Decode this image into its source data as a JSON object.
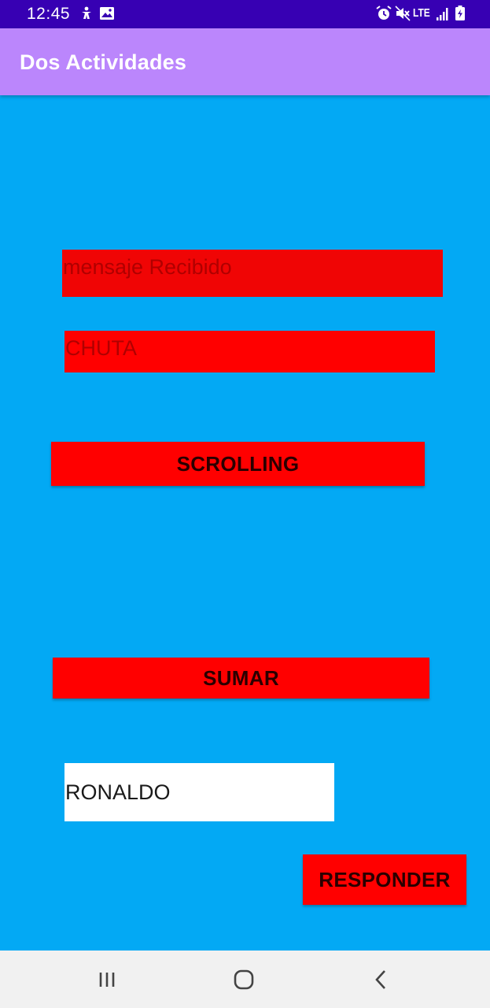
{
  "status_bar": {
    "time": "12:45",
    "network_label": "LTE",
    "icons": [
      "accessibility-icon",
      "image-icon",
      "alarm-icon",
      "mute-icon",
      "signal-icon",
      "battery-charging-icon"
    ]
  },
  "app_bar": {
    "title": "Dos Actividades"
  },
  "main": {
    "message_label": "mensaje Recibido",
    "received_text": "CHUTA",
    "scrolling_button": "SCROLLING",
    "sumar_button": "SUMAR",
    "reply_input_value": "RONALDO",
    "responder_button": "RESPONDER"
  },
  "colors": {
    "status_bar": "#3700B3",
    "app_bar": "#BB86FC",
    "background": "#03A9F4",
    "accent_red": "#FF0000",
    "nav_bar": "#F1F1F1"
  },
  "nav_bar": {
    "buttons": [
      "recents-icon",
      "home-icon",
      "back-icon"
    ]
  }
}
